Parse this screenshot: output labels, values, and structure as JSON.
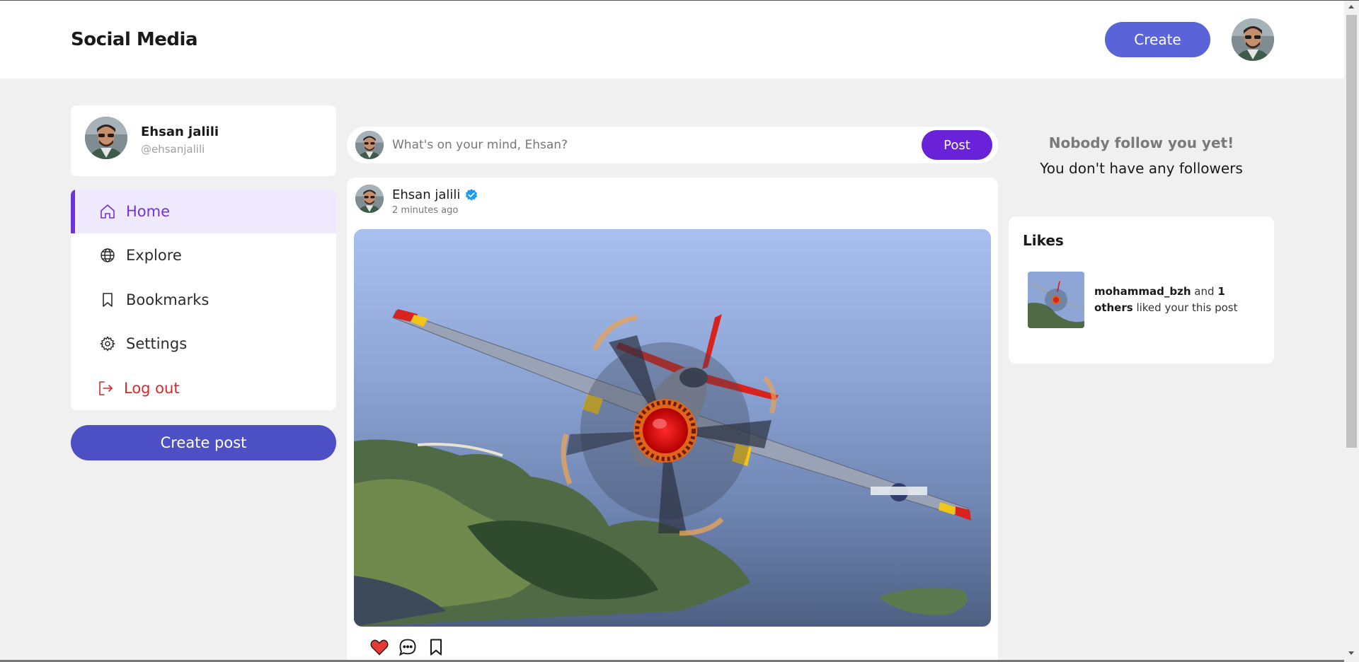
{
  "header": {
    "brand": "Social Media",
    "create_label": "Create"
  },
  "profile": {
    "name": "Ehsan jalili",
    "handle": "@ehsanjalili"
  },
  "nav": {
    "items": [
      {
        "label": "Home",
        "icon": "home-icon",
        "active": true
      },
      {
        "label": "Explore",
        "icon": "globe-icon",
        "active": false
      },
      {
        "label": "Bookmarks",
        "icon": "bookmark-icon",
        "active": false
      },
      {
        "label": "Settings",
        "icon": "gear-icon",
        "active": false
      },
      {
        "label": "Log out",
        "icon": "logout-icon",
        "active": false
      }
    ],
    "create_post_label": "Create post"
  },
  "composer": {
    "placeholder": "What's on your mind, Ehsan?",
    "post_label": "Post"
  },
  "post": {
    "author": "Ehsan jalili",
    "time": "2 minutes ago",
    "verified": true,
    "liked": true,
    "image_subject": "aircraft"
  },
  "followers": {
    "title": "Nobody follow you yet!",
    "subtitle": "You don't have any followers"
  },
  "likes": {
    "title": "Likes",
    "user": "mohammad_bzh",
    "connector": "and",
    "count": "1",
    "others_label": "others",
    "suffix": "liked your this post"
  },
  "colors": {
    "accent": "#6a22d9",
    "create_button": "#5a63d8",
    "create_post_button": "#4c50c4",
    "logout": "#d62a2a",
    "like": "#e53935",
    "verified": "#1d9bf0"
  }
}
